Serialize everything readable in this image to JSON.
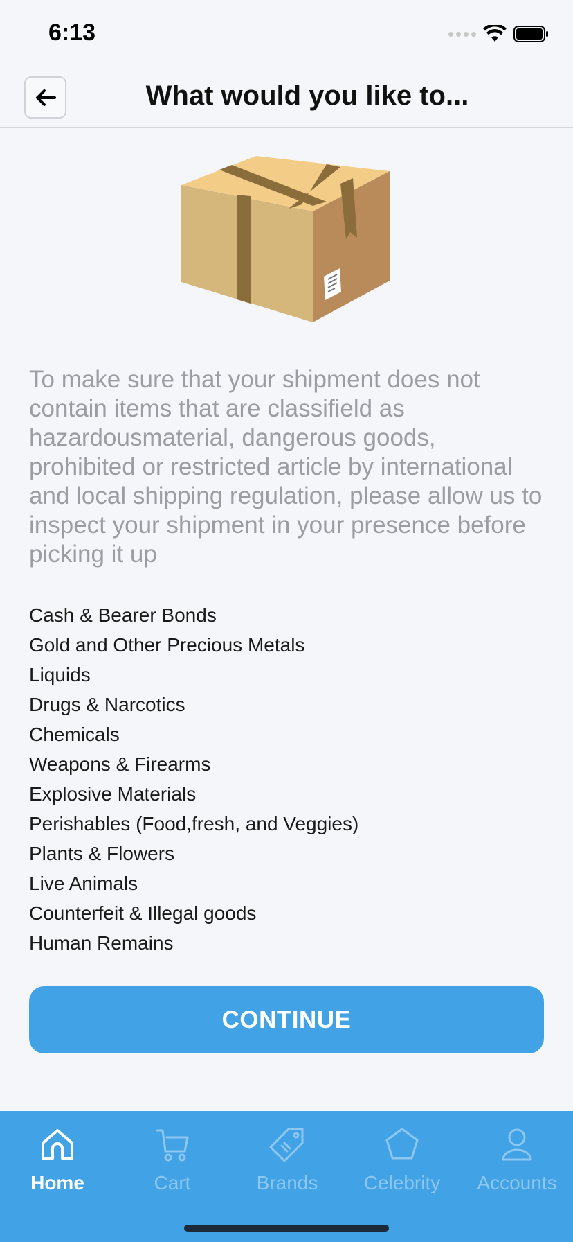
{
  "status_bar": {
    "time": "6:13"
  },
  "header": {
    "title": "What would you like to..."
  },
  "intro_text": "To make sure that your shipment does not contain items that are classifield as hazardousmaterial, dangerous goods, prohibited or restricted article by international and local shipping regulation, please allow us to inspect your shipment in your presence before picking it up",
  "restricted_items": [
    "Cash & Bearer Bonds",
    "Gold and Other Precious Metals",
    "Liquids",
    "Drugs & Narcotics",
    "Chemicals",
    "Weapons & Firearms",
    "Explosive Materials",
    "Perishables (Food,fresh, and Veggies)",
    "Plants & Flowers",
    "Live Animals",
    "Counterfeit & Illegal goods",
    "Human Remains"
  ],
  "continue_label": "CONTINUE",
  "tabs": [
    {
      "label": "Home",
      "icon": "home-icon",
      "active": true
    },
    {
      "label": "Cart",
      "icon": "cart-icon",
      "active": false
    },
    {
      "label": "Brands",
      "icon": "tag-icon",
      "active": false
    },
    {
      "label": "Celebrity",
      "icon": "star-icon",
      "active": false
    },
    {
      "label": "Accounts",
      "icon": "user-icon",
      "active": false
    }
  ],
  "colors": {
    "accent": "#41a2e5",
    "background": "#f4f6f9",
    "muted_text": "#9a9da2",
    "tab_inactive": "#8ec7ef"
  }
}
